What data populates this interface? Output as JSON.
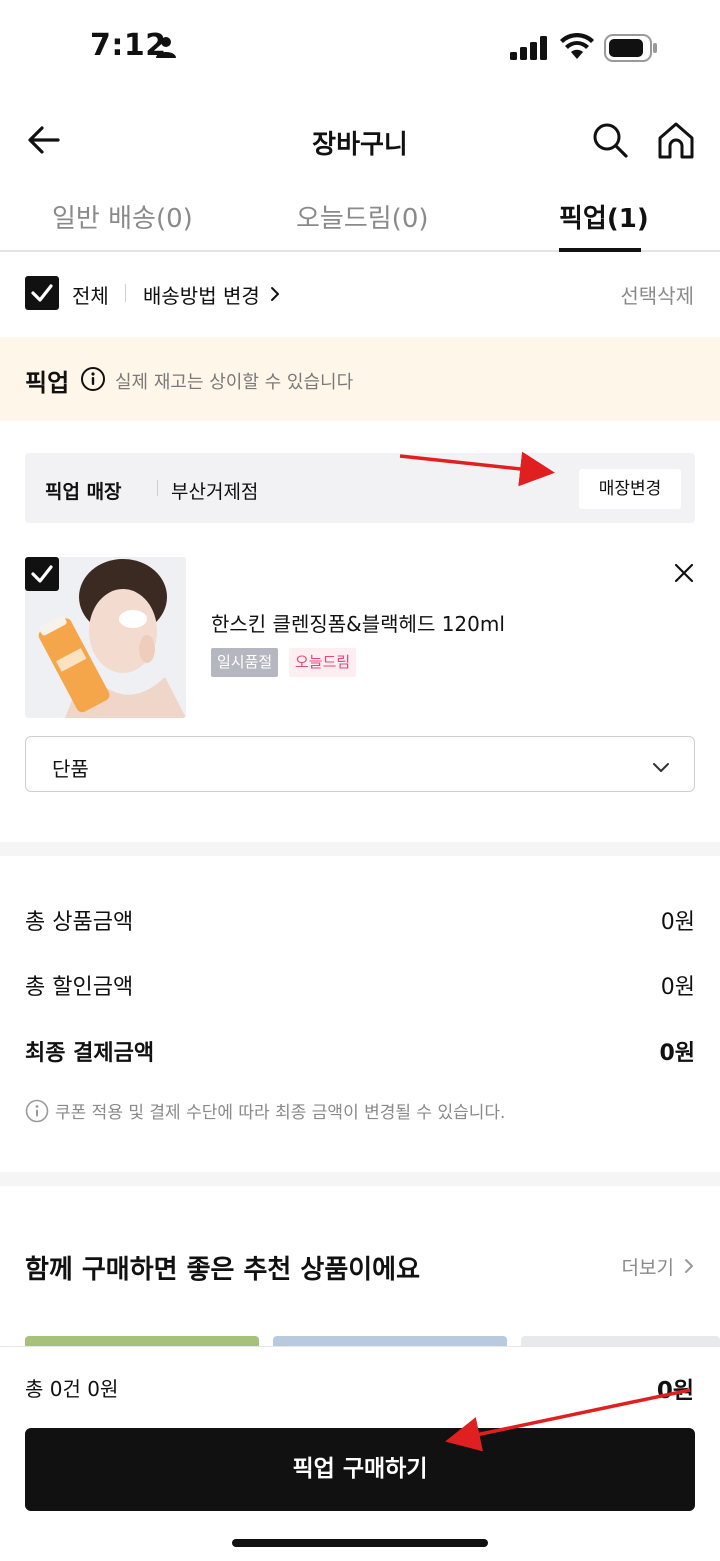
{
  "status": {
    "time": "7:12"
  },
  "nav": {
    "title": "장바구니"
  },
  "tabs": [
    {
      "label": "일반 배송(0)"
    },
    {
      "label": "오늘드림(0)"
    },
    {
      "label": "픽업(1)"
    }
  ],
  "selection": {
    "all_label": "전체",
    "shipping_change": "배송방법 변경",
    "delete_selected": "선택삭제"
  },
  "pickup": {
    "title": "픽업",
    "notice": "실제 재고는 상이할 수 있습니다",
    "store_label": "픽업 매장",
    "store_name": "부산거제점",
    "store_change": "매장변경"
  },
  "product": {
    "name": "한스킨 클렌징폼&블랙헤드 120ml",
    "badges": [
      "일시품절",
      "오늘드림"
    ],
    "option": "단품"
  },
  "summary": {
    "rows": [
      {
        "label": "총 상품금액",
        "value": "0원"
      },
      {
        "label": "총 할인금액",
        "value": "0원"
      },
      {
        "label": "최종 결제금액",
        "value": "0원"
      }
    ],
    "note": "쿠폰 적용 및 결제 수단에 따라 최종 금액이 변경될 수 있습니다."
  },
  "recommend": {
    "title": "함께 구매하면 좋은 추천 상품이에요",
    "more": "더보기"
  },
  "bottom": {
    "count": "총 0건 0원",
    "amount": "0원",
    "button": "픽업 구매하기"
  },
  "colors": {
    "banner_bg": "#fff6ea",
    "badge_soldout": "#b4b7bf",
    "badge_today": "#e6477c",
    "primary": "#111111",
    "annotation_arrow": "#e02020"
  }
}
